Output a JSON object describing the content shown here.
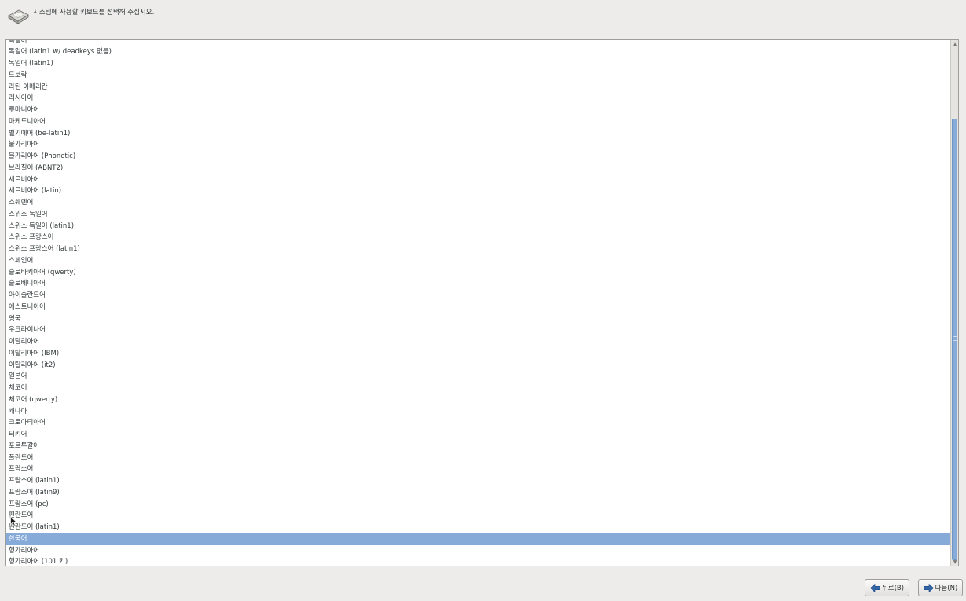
{
  "header": {
    "prompt": "시스템에 사용할 키보드를 선택해 주십시오.",
    "icon": "keyboard-icon"
  },
  "keyboard_list": {
    "items": [
      "독일어",
      "독일어 (latin1 w/ deadkeys 없음)",
      "독일어 (latin1)",
      "드보락",
      "라틴 아메리칸",
      "러시아어",
      "루마니아어",
      "마케도니아어",
      "벨기에어 (be-latin1)",
      "불가리아어",
      "불가리아어 (Phonetic)",
      "브라질어 (ABNT2)",
      "세르비아어",
      "세르비아어 (latin)",
      "스웨덴어",
      "스위스 독일어",
      "스위스 독일어 (latin1)",
      "스위스 프랑스어",
      "스위스 프랑스어 (latin1)",
      "스페인어",
      "슬로바키아어 (qwerty)",
      "슬로베니아어",
      "아이슬란드어",
      "에스토니아어",
      "영국",
      "우크라이나어",
      "이탈리아어",
      "이탈리아어 (IBM)",
      "이탈리아어 (it2)",
      "일본어",
      "체코어",
      "체코어 (qwerty)",
      "캐나다",
      "크로아티아어",
      "터키어",
      "포르투갈어",
      "폴란드어",
      "프랑스어",
      "프랑스어 (latin1)",
      "프랑스어 (latin9)",
      "프랑스어 (pc)",
      "핀란드어",
      "핀란드어 (latin1)",
      "한국어",
      "헝가리아어",
      "헝가리아어 (101 키)"
    ],
    "selected": "한국어",
    "selection_color": "#86abd9"
  },
  "buttons": {
    "back_label": "뒤로(B)",
    "next_label": "다음(N)",
    "back_icon": "arrow-left-icon",
    "next_icon": "arrow-right-icon"
  },
  "colors": {
    "background": "#edeceb",
    "accent": "#86abd9",
    "arrow_blue": "#3465a4"
  }
}
